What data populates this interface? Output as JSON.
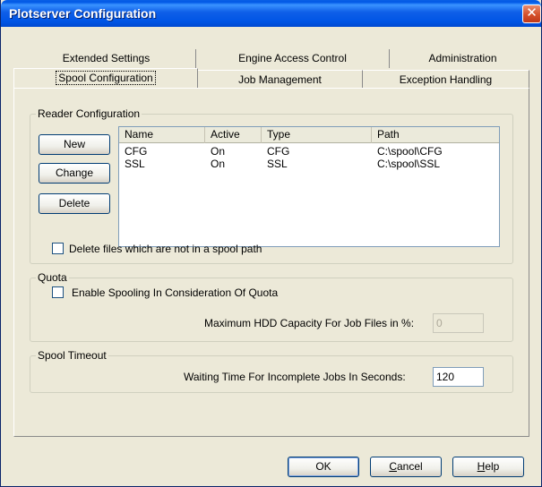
{
  "window": {
    "title": "Plotserver Configuration",
    "close_glyph": "✕"
  },
  "tabs": {
    "row1": [
      "Extended Settings",
      "Engine Access Control",
      "Administration"
    ],
    "row2": [
      "Spool Configuration",
      "Job Management",
      "Exception Handling"
    ],
    "active": "Spool Configuration"
  },
  "reader": {
    "group_title": "Reader Configuration",
    "buttons": {
      "new": "New",
      "change": "Change",
      "delete": "Delete"
    },
    "columns": [
      "Name",
      "Active",
      "Type",
      "Path"
    ],
    "rows": [
      {
        "name": "CFG",
        "active": "On",
        "type": "CFG",
        "path": "C:\\spool\\CFG"
      },
      {
        "name": "SSL",
        "active": "On",
        "type": "SSL",
        "path": "C:\\spool\\SSL"
      }
    ],
    "delete_files_label": "Delete files which are not in a spool path",
    "delete_files_checked": false
  },
  "quota": {
    "group_title": "Quota",
    "enable_label": "Enable Spooling In Consideration Of Quota",
    "enable_checked": false,
    "max_capacity_label": "Maximum HDD Capacity For Job Files in %:",
    "max_capacity_value": "0"
  },
  "timeout": {
    "group_title": "Spool Timeout",
    "waiting_label": "Waiting Time For Incomplete Jobs In Seconds:",
    "waiting_value": "120"
  },
  "footer": {
    "ok": "OK",
    "cancel_first": "C",
    "cancel_rest": "ancel",
    "help_first": "H",
    "help_rest": "elp"
  }
}
